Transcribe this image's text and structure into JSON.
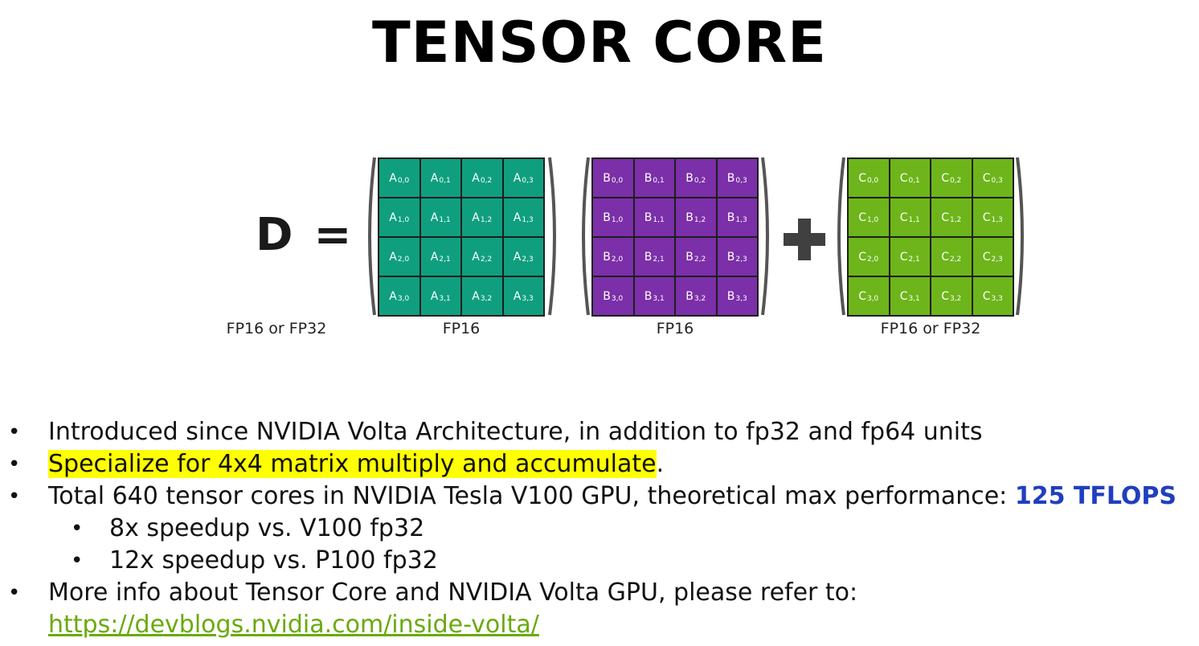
{
  "slide": {
    "title": "TENSOR CORE"
  },
  "diagram": {
    "lhs": "D",
    "equals": "=",
    "matrix_a": {
      "letter": "A",
      "precision": "FP16",
      "color": "#0f9f7f"
    },
    "matrix_b": {
      "letter": "B",
      "precision": "FP16",
      "color": "#7b2fa8"
    },
    "matrix_c": {
      "letter": "C",
      "precision": "FP16 or FP32",
      "color": "#6db51b"
    },
    "result_precision": "FP16 or FP32",
    "operator_icon": "plus-icon",
    "size": 4
  },
  "bullets": {
    "b1": "Introduced since NVIDIA Volta Architecture, in addition to fp32 and fp64 units",
    "b2_highlight": "Specialize for 4x4 matrix multiply and accumulate",
    "b2_tail": ".",
    "b3_text": "Total 640 tensor cores in NVIDIA Tesla V100 GPU, theoretical max performance: ",
    "b3_perf": "125 TFLOPS",
    "b3_sub1": "8x speedup vs. V100 fp32",
    "b3_sub2": "12x speedup vs. P100 fp32",
    "b4_text": "More info about Tensor Core and NVIDIA Volta GPU, please refer to:",
    "b4_link": "https://devblogs.nvidia.com/inside-volta/"
  }
}
